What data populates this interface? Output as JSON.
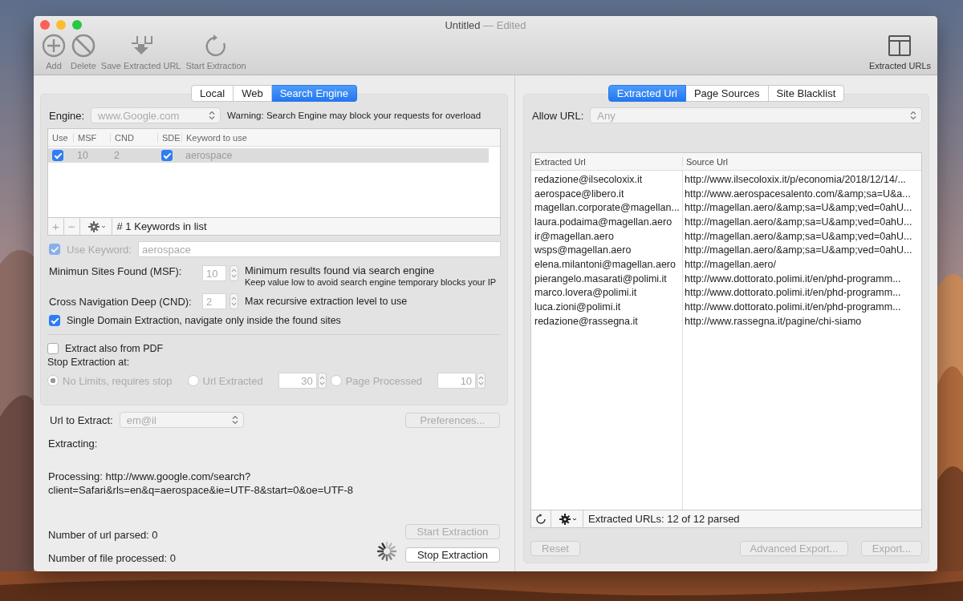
{
  "window": {
    "title": "Untitled",
    "title_suffix": "— Edited"
  },
  "toolbar": {
    "items": [
      {
        "label": "Add",
        "kind": "add",
        "disabled": false
      },
      {
        "label": "Delete",
        "kind": "delete",
        "disabled": false
      },
      {
        "label": "Save Extracted URL",
        "kind": "save",
        "disabled": false
      },
      {
        "label": "Start Extraction",
        "kind": "start",
        "disabled": false
      }
    ],
    "right_item": {
      "label": "Extracted URLs",
      "kind": "panel",
      "disabled": false
    }
  },
  "left": {
    "tabs": [
      {
        "label": "Local",
        "selected": false
      },
      {
        "label": "Web",
        "selected": false
      },
      {
        "label": "Search Engine",
        "selected": true
      }
    ],
    "engine": {
      "label": "Engine:",
      "value": "www.Google.com",
      "warning": "Warning: Search Engine may block your requests for overload"
    },
    "keywords_table": {
      "columns": [
        "Use",
        "MSF",
        "CND",
        "SDE",
        "Keyword to use"
      ],
      "rows": [
        {
          "use": true,
          "msf": "10",
          "cnd": "2",
          "sde": true,
          "keyword": "aerospace",
          "selected": true
        }
      ],
      "add": "+",
      "remove": "−",
      "status": "# 1 Keywords in list"
    },
    "use_keyword": {
      "label": "Use Keyword:",
      "checked": true,
      "value": "aerospace"
    },
    "msf": {
      "label": "Minimun Sites Found (MSF):",
      "value": "10",
      "hint": "Minimum results found via search engine",
      "subhint": "Keep value low to avoid search engine temporary blocks your IP"
    },
    "cnd": {
      "label": "Cross Navigation Deep (CND):",
      "value": "2",
      "hint": "Max recursive extraction level to use"
    },
    "single_domain": {
      "label": "Single Domain Extraction, navigate only inside the found sites",
      "checked": true
    },
    "pdf": {
      "label": "Extract also from PDF",
      "checked": false
    },
    "stop_label": "Stop Extraction at:",
    "stop_options": [
      {
        "label": "No Limits, requires stop",
        "selected": true
      },
      {
        "label": "Url Extracted",
        "selected": false,
        "value": "30"
      },
      {
        "label": "Page Processed",
        "selected": false,
        "value": "10"
      }
    ],
    "url_to_extract": {
      "label": "Url to Extract:",
      "value": "em@il"
    },
    "preferences": {
      "label": "Preferences...",
      "disabled": true
    },
    "extracting": "Extracting:",
    "processing": "Processing: http://www.google.com/search?client=Safari&rls=en&q=aerospace&ie=UTF-8&start=0&oe=UTF-8",
    "url_parsed": "Number of url parsed: 0",
    "file_processed": "Number of file processed: 0",
    "start_button": {
      "label": "Start Extraction",
      "disabled": true
    },
    "stop_button": {
      "label": "Stop Extraction",
      "disabled": false
    }
  },
  "right": {
    "tabs": [
      {
        "label": "Extracted Url",
        "selected": true
      },
      {
        "label": "Page Sources",
        "selected": false
      },
      {
        "label": "Site Blacklist",
        "selected": false
      }
    ],
    "allow_url": {
      "label": "Allow URL:",
      "value": "Any"
    },
    "table": {
      "columns": [
        "Extracted Url",
        "Source Url"
      ],
      "rows": [
        [
          "redazione@ilsecoloxix.it",
          "http://www.ilsecoloxix.it/p/economia/2018/12/14/..."
        ],
        [
          "aerospace@libero.it",
          "http://www.aerospacesalento.com/&amp;sa=U&a..."
        ],
        [
          "magellan.corporate@magellan...",
          "http://magellan.aero/&amp;sa=U&amp;ved=0ahU..."
        ],
        [
          "laura.podaima@magellan.aero",
          "http://magellan.aero/&amp;sa=U&amp;ved=0ahU..."
        ],
        [
          "ir@magellan.aero",
          "http://magellan.aero/&amp;sa=U&amp;ved=0ahU..."
        ],
        [
          "wsps@magellan.aero",
          "http://magellan.aero/&amp;sa=U&amp;ved=0ahU..."
        ],
        [
          "elena.milantoni@magellan.aero",
          "http://magellan.aero/"
        ],
        [
          "pierangelo.masarati@polimi.it",
          "http://www.dottorato.polimi.it/en/phd-programm..."
        ],
        [
          "marco.lovera@polimi.it",
          "http://www.dottorato.polimi.it/en/phd-programm..."
        ],
        [
          "luca.zioni@polimi.it",
          "http://www.dottorato.polimi.it/en/phd-programm..."
        ],
        [
          "redazione@rassegna.it",
          "http://www.rassegna.it/pagine/chi-siamo"
        ]
      ],
      "status": "Extracted URLs: 12 of  12 parsed"
    },
    "buttons": [
      {
        "label": "Reset",
        "disabled": true
      },
      {
        "label": "Advanced Export...",
        "disabled": true
      },
      {
        "label": "Export...",
        "disabled": true
      }
    ]
  }
}
